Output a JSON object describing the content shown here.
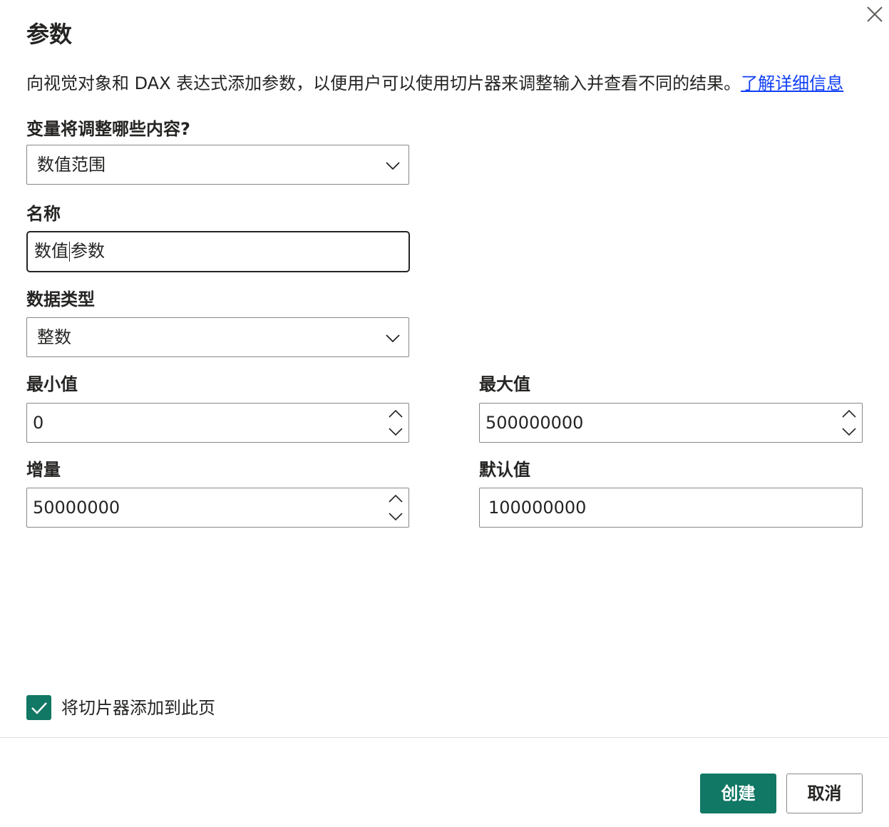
{
  "dialog": {
    "title": "参数",
    "description": "向视觉对象和 DAX 表达式添加参数，以便用户可以使用切片器来调整输入并查看不同的结果。",
    "learn_more": "了解详细信息"
  },
  "fields": {
    "variable": {
      "label": "变量将调整哪些内容?",
      "value": "数值范围"
    },
    "name": {
      "label": "名称",
      "value_before_cursor": "数值",
      "value_after_cursor": "参数"
    },
    "data_type": {
      "label": "数据类型",
      "value": "整数"
    },
    "min": {
      "label": "最小值",
      "value": "0"
    },
    "max": {
      "label": "最大值",
      "value": "500000000"
    },
    "increment": {
      "label": "增量",
      "value": "50000000"
    },
    "default": {
      "label": "默认值",
      "value": "100000000"
    }
  },
  "slicer_checkbox": {
    "label": "将切片器添加到此页",
    "checked": true
  },
  "buttons": {
    "create": "创建",
    "cancel": "取消"
  },
  "colors": {
    "accent": "#117865",
    "link": "#0f3ef5",
    "text": "#252423",
    "border": "#8a8886"
  },
  "icons": {
    "close": "close-icon",
    "dropdown": "chevron-down-icon",
    "spin_up": "chevron-up-icon",
    "spin_down": "chevron-down-icon",
    "check": "checkmark-icon"
  }
}
